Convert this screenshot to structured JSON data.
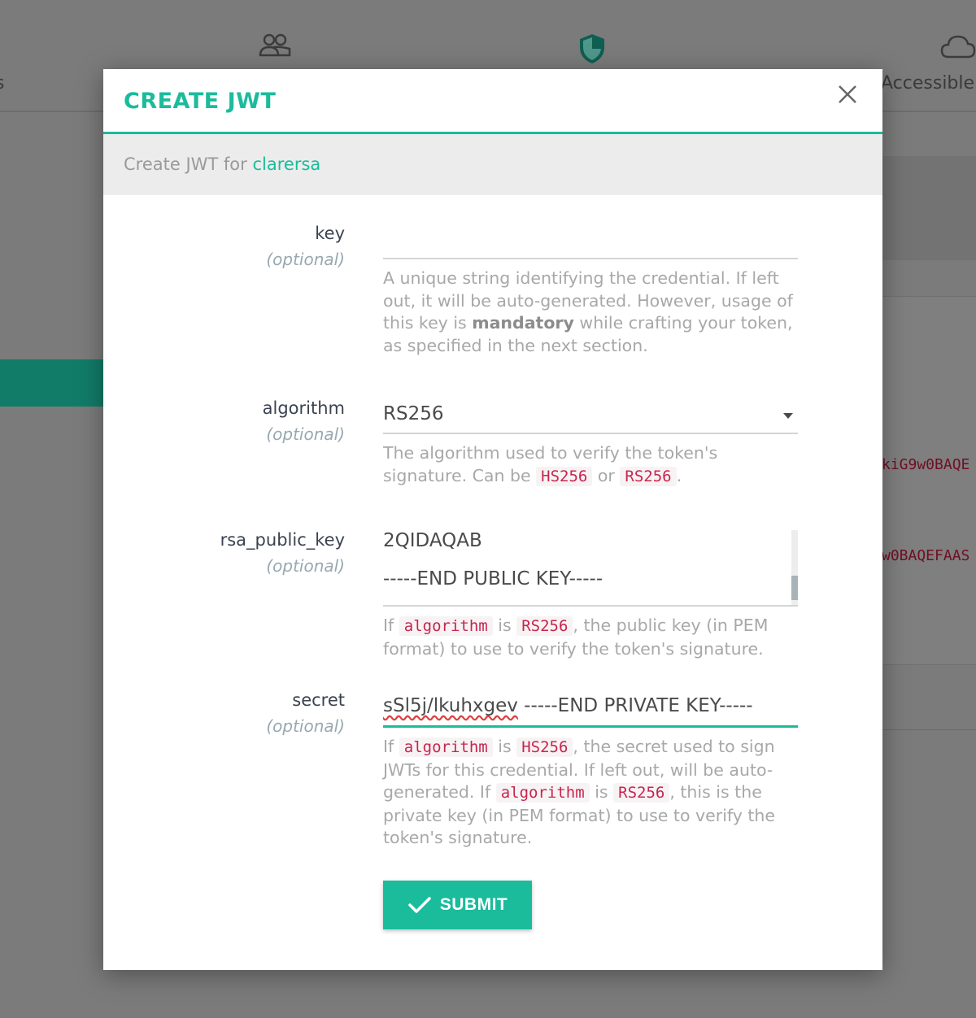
{
  "background": {
    "nav_left_label": "s",
    "nav_accessible_label": "Accessible",
    "nav_icons": [
      "users-icon",
      "shield-icon",
      "cloud-icon"
    ],
    "code_line_1": "kiG9w0BAQE",
    "code_line_2": "w0BAQEFAAS"
  },
  "modal": {
    "title": "CREATE JWT",
    "close_icon": "close-icon",
    "subheader_prefix": "Create JWT for",
    "consumer": "clarersa",
    "fields": {
      "key": {
        "label": "key",
        "optional": "(optional)",
        "value": "",
        "help_1": "A unique string identifying the credential. If left out, it will be auto-generated. However, usage of this key is",
        "help_bold": "mandatory",
        "help_2": "while crafting your token, as specified in the next section."
      },
      "algorithm": {
        "label": "algorithm",
        "optional": "(optional)",
        "selected": "RS256",
        "help_1": "The algorithm used to verify the token's signature. Can be",
        "code_1": "HS256",
        "help_or": "or",
        "code_2": "RS256",
        "help_end": "."
      },
      "rsa_public_key": {
        "label": "rsa_public_key",
        "optional": "(optional)",
        "line_1": "2QIDAQAB",
        "line_2": "-----END PUBLIC KEY-----",
        "help_if": "If",
        "code_1": "algorithm",
        "help_is": "is",
        "code_2": "RS256",
        "help_rest": ", the public key (in PEM format) to use to verify the token's signature."
      },
      "secret": {
        "label": "secret",
        "optional": "(optional)",
        "value_misspelled": "sSl5j/lkuhxgev",
        "value_rest": " -----END PRIVATE KEY-----",
        "help_if": "If",
        "code_1": "algorithm",
        "help_is": "is",
        "code_2": "HS256",
        "help_mid": ", the secret used to sign JWTs for this credential. If left out, will be auto-generated. If",
        "code_3": "algorithm",
        "help_is2": "is",
        "code_4": "RS256",
        "help_end": ", this is the private key (in PEM format) to use to verify the token's signature."
      }
    },
    "submit_label": "SUBMIT",
    "colors": {
      "accent": "#1abc9c",
      "code": "#c7254e"
    }
  }
}
